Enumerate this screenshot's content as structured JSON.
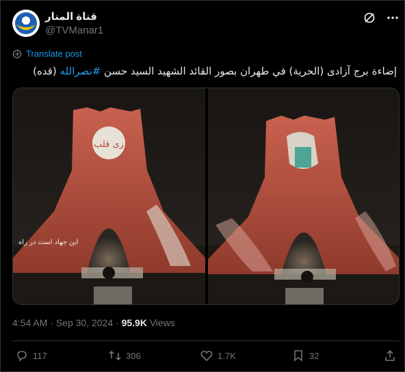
{
  "account": {
    "display_name": "قناة المنار",
    "handle": "@TVManar1"
  },
  "translate_label": "Translate post",
  "post": {
    "text_main": "إضاءة برج آزادی (الحرية) في طهران بصور القائد الشهيد السيد حسن",
    "hashtag": "#نصرالله",
    "text_tail": "(قده)"
  },
  "images": [
    {
      "banner_text": "زی قلب",
      "side_text": "این جهاد است در راه"
    },
    {
      "banner_text": "",
      "side_text": ""
    }
  ],
  "meta": {
    "time": "4:54 AM",
    "separator1": "·",
    "date": "Sep 30, 2024",
    "separator2": "·",
    "views_count": "95.9K",
    "views_label": "Views"
  },
  "actions": {
    "replies": "117",
    "reposts": "306",
    "likes": "1.7K",
    "bookmarks": "32"
  },
  "colors": {
    "accent": "#1d9bf0",
    "muted": "#71767b",
    "text": "#e7e9ea",
    "background": "#000000"
  }
}
